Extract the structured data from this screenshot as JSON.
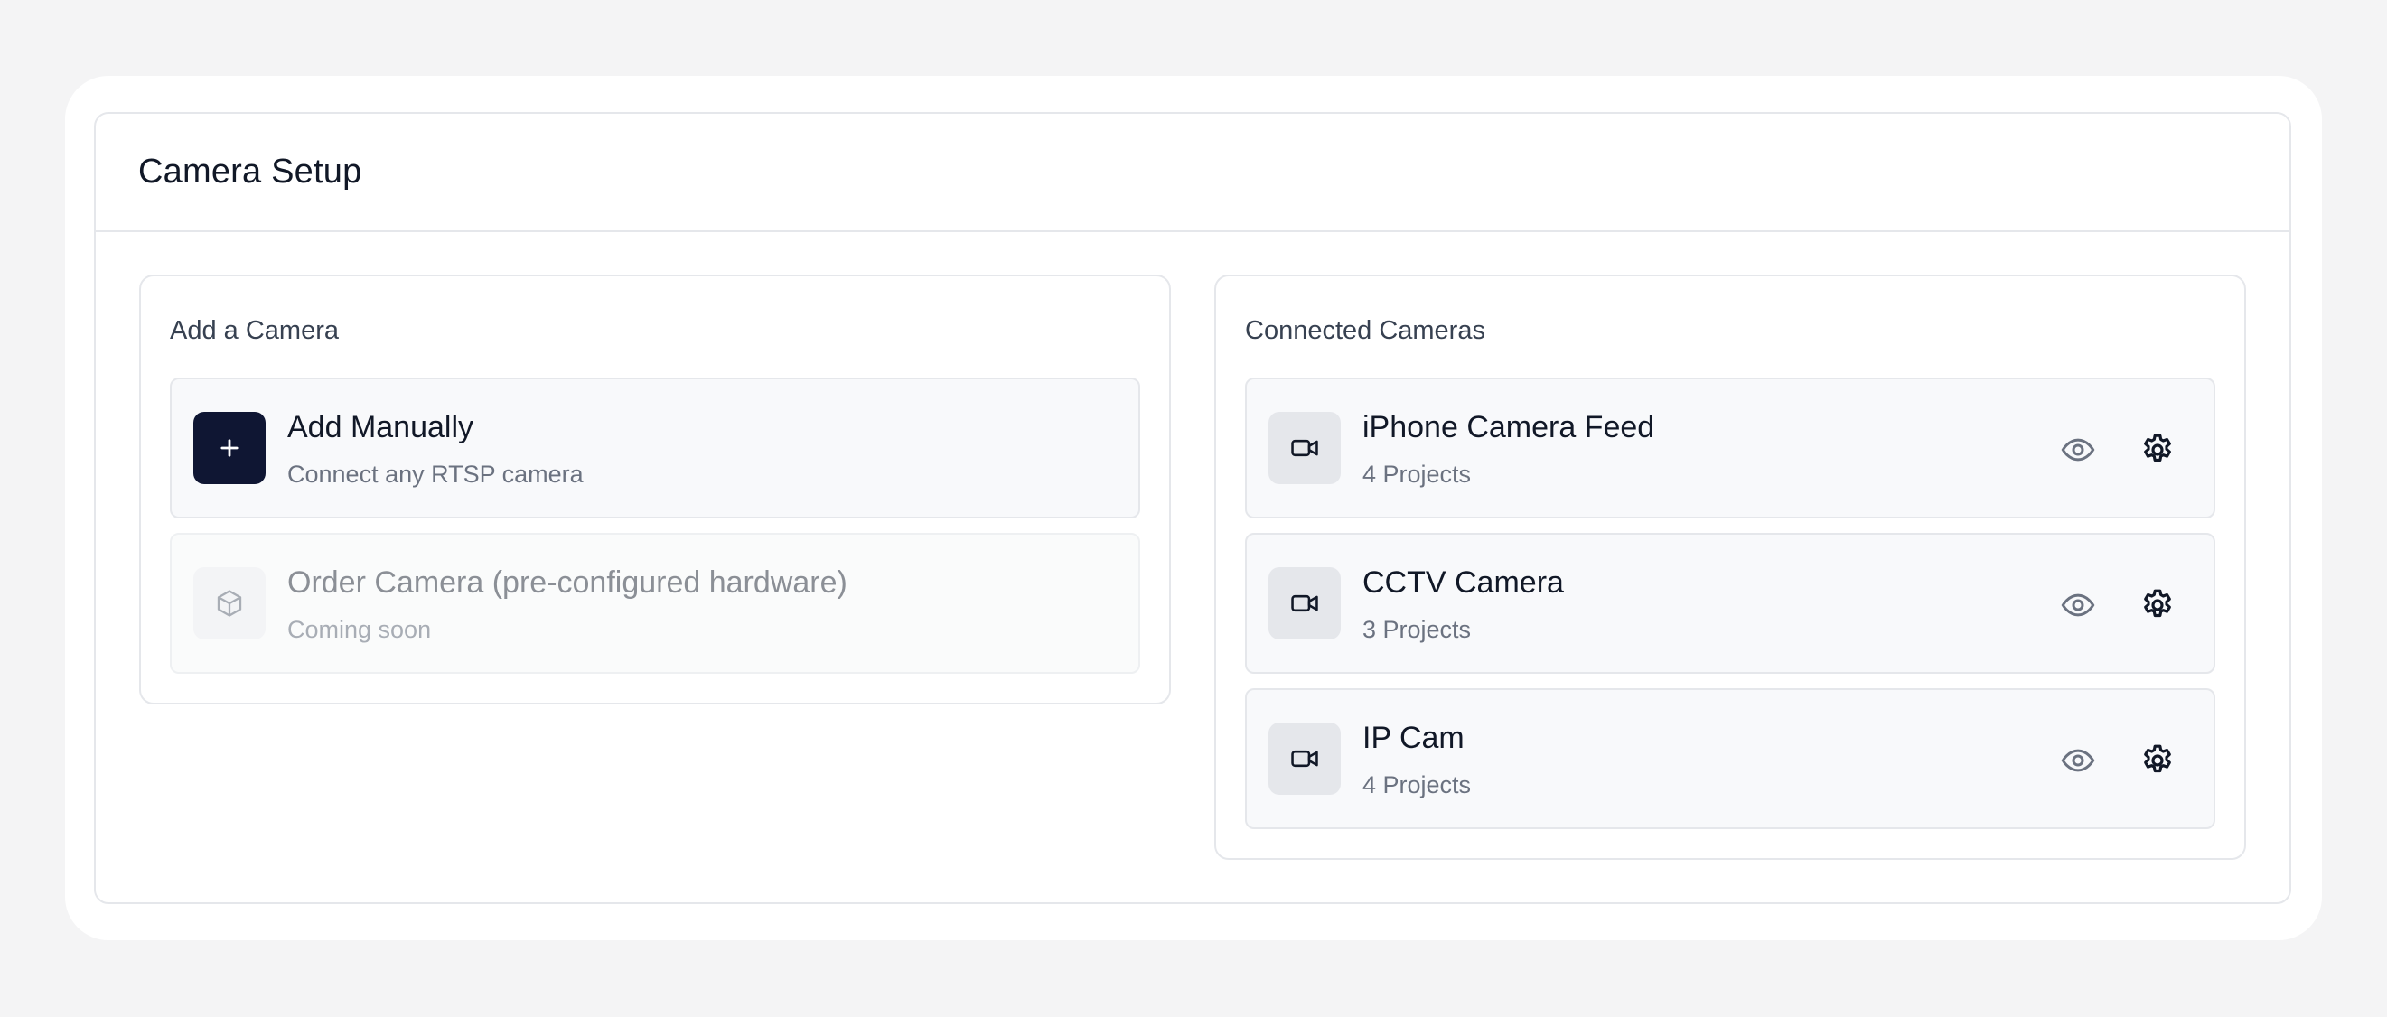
{
  "page": {
    "title": "Camera Setup"
  },
  "add_panel": {
    "title": "Add a Camera",
    "options": [
      {
        "title": "Add Manually",
        "subtitle": "Connect any RTSP camera",
        "icon": "plus-icon",
        "enabled": true
      },
      {
        "title": "Order Camera (pre-configured hardware)",
        "subtitle": "Coming soon",
        "icon": "box-icon",
        "enabled": false
      }
    ]
  },
  "connected_panel": {
    "title": "Connected Cameras",
    "cameras": [
      {
        "name": "iPhone Camera Feed",
        "projects": "4 Projects",
        "icon": "video-camera-icon"
      },
      {
        "name": "CCTV Camera",
        "projects": "3 Projects",
        "icon": "video-camera-icon"
      },
      {
        "name": "IP Cam",
        "projects": "4 Projects",
        "icon": "video-camera-icon"
      }
    ]
  },
  "colors": {
    "accent_dark": "#0f1633",
    "border": "#e5e7eb",
    "row_background": "#f8f9fb",
    "page_background": "#f4f4f5"
  }
}
